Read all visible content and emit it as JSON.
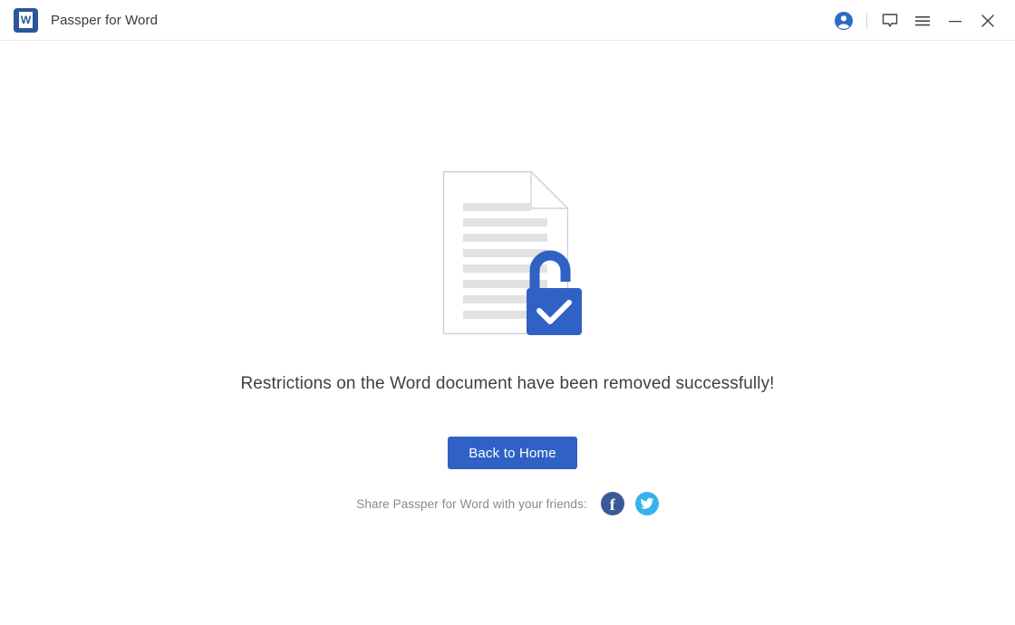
{
  "window": {
    "app_title": "Passper for Word",
    "logo_letter": "W",
    "logo_icon": "word-document-logo",
    "controls": {
      "account_icon": "account-circle-icon",
      "feedback_icon": "speech-bubble-icon",
      "menu_icon": "hamburger-menu-icon",
      "minimize_icon": "minimize-icon",
      "close_icon": "close-icon"
    }
  },
  "main": {
    "illustration": {
      "name": "document-unlocked-illustration",
      "document_icon": "document-with-folded-corner",
      "lock_icon": "open-padlock-with-check",
      "text_line_count": 8
    },
    "message": "Restrictions on the Word document have been removed successfully!",
    "primary_button": "Back to Home",
    "share": {
      "label": "Share Passper for Word with your friends:",
      "facebook_icon": "facebook-icon",
      "facebook_letter": "f",
      "twitter_icon": "twitter-icon"
    }
  },
  "colors": {
    "accent_blue": "#2f62c4",
    "logo_blue": "#2b579a",
    "account_blue": "#2d6cc4",
    "facebook_blue": "#3b5998",
    "twitter_blue": "#35b3ec",
    "doc_line_gray": "#e2e2e2",
    "text_dark": "#404040",
    "text_muted": "#8a8a8a"
  }
}
